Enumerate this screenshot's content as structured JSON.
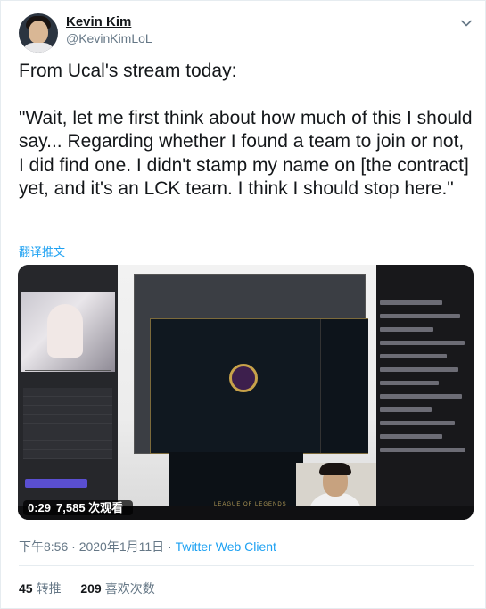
{
  "author": {
    "name": "Kevin Kim",
    "handle": "@KevinKimLoL"
  },
  "tweet": {
    "line1": "From Ucal's stream today:",
    "line2": "\"Wait, let me first think about how much of this I should say... Regarding whether I found a team to join or not, I did find one. I didn't stamp my name on [the contract] yet, and it's an LCK team. I think I should stop here.\""
  },
  "translate_label": "翻译推文",
  "media": {
    "duration": "0:29",
    "views": "7,585 次观看",
    "game_logo": "LEAGUE OF LEGENDS"
  },
  "meta": {
    "timestamp": "下午8:56 · 2020年1月11日 · ",
    "client": "Twitter Web Client"
  },
  "stats": {
    "retweets_count": "45",
    "retweets_label": "转推",
    "likes_count": "209",
    "likes_label": "喜欢次数"
  },
  "colors": {
    "link": "#1da1f2",
    "secondary_text": "#657786",
    "primary_text": "#14171a"
  },
  "icons": [
    "chevron-down-icon"
  ]
}
